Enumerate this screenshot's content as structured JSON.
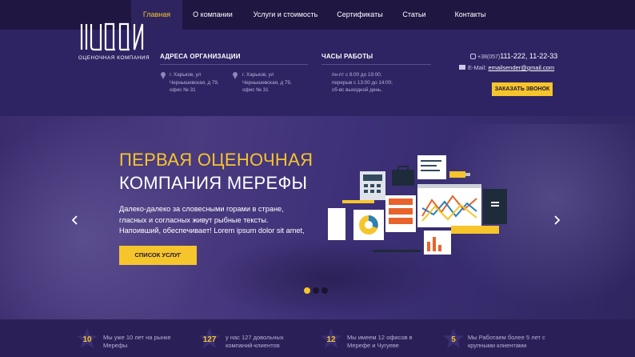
{
  "nav": {
    "items": [
      {
        "label": "Главная",
        "active": true
      },
      {
        "label": "О компании",
        "active": false
      },
      {
        "label": "Услуги и стоимость",
        "active": false
      },
      {
        "label": "Сертификаты",
        "active": false
      },
      {
        "label": "Статьи",
        "active": false
      },
      {
        "label": "Контакты",
        "active": false
      }
    ]
  },
  "header": {
    "logo_text": "ОЦЕНОЧНАЯ КОМПАНИЯ",
    "address_title": "АДРЕСА ОРГАНИЗАЦИИ",
    "addresses": [
      {
        "line1": "г. Харьков, ул",
        "line2": "Чернышевская, д 79,",
        "line3": "офис № 31"
      },
      {
        "line1": "г. Харьков, ул",
        "line2": "Чернышевская, д 79,",
        "line3": "офис № 31"
      }
    ],
    "hours_title": "ЧАСЫ РАБОТЫ",
    "hours": {
      "line1": "пн-пт с 8:00 до 19:00;",
      "line2": "перерыв с 13:00 до 14:00;",
      "line3": "сб-вс выходной день."
    },
    "phone_code": "+38(057)",
    "phone_numbers": "111-222, 11-22-33",
    "email_label": "E-Mail:",
    "email": "emailsender@gmail.com",
    "call_button": "ЗАКАЗАТЬ ЗВОНОК"
  },
  "hero": {
    "title_line1": "ПЕРВАЯ ОЦЕНОЧНАЯ",
    "title_line2": "КОМПАНИЯ МЕРЕФЫ",
    "text": "Далеко-далеко за словесными горами в стране, гласных и согласных живут рыбные тексты. Напоивший, обеспечивает! Lorem ipsum dolor sit amet,",
    "button": "СПИСОК УСЛУГ",
    "slides": 3,
    "active_slide": 0
  },
  "stats": [
    {
      "number": "10",
      "text": "Мы уже 10 лет на рынке Мерефы"
    },
    {
      "number": "127",
      "text": "у нас 127 довольных компаний-клиентов"
    },
    {
      "number": "12",
      "text": "Мы имеем 12 офисов в Мерефе и Чугуеве"
    },
    {
      "number": "5",
      "text": "Мы Работаем более 5 лет с крупными клиентами"
    }
  ],
  "colors": {
    "accent": "#f6c52b",
    "nav_bg": "#1f1642",
    "header_bg": "#2e2463",
    "page_bg": "#2b1f57"
  }
}
